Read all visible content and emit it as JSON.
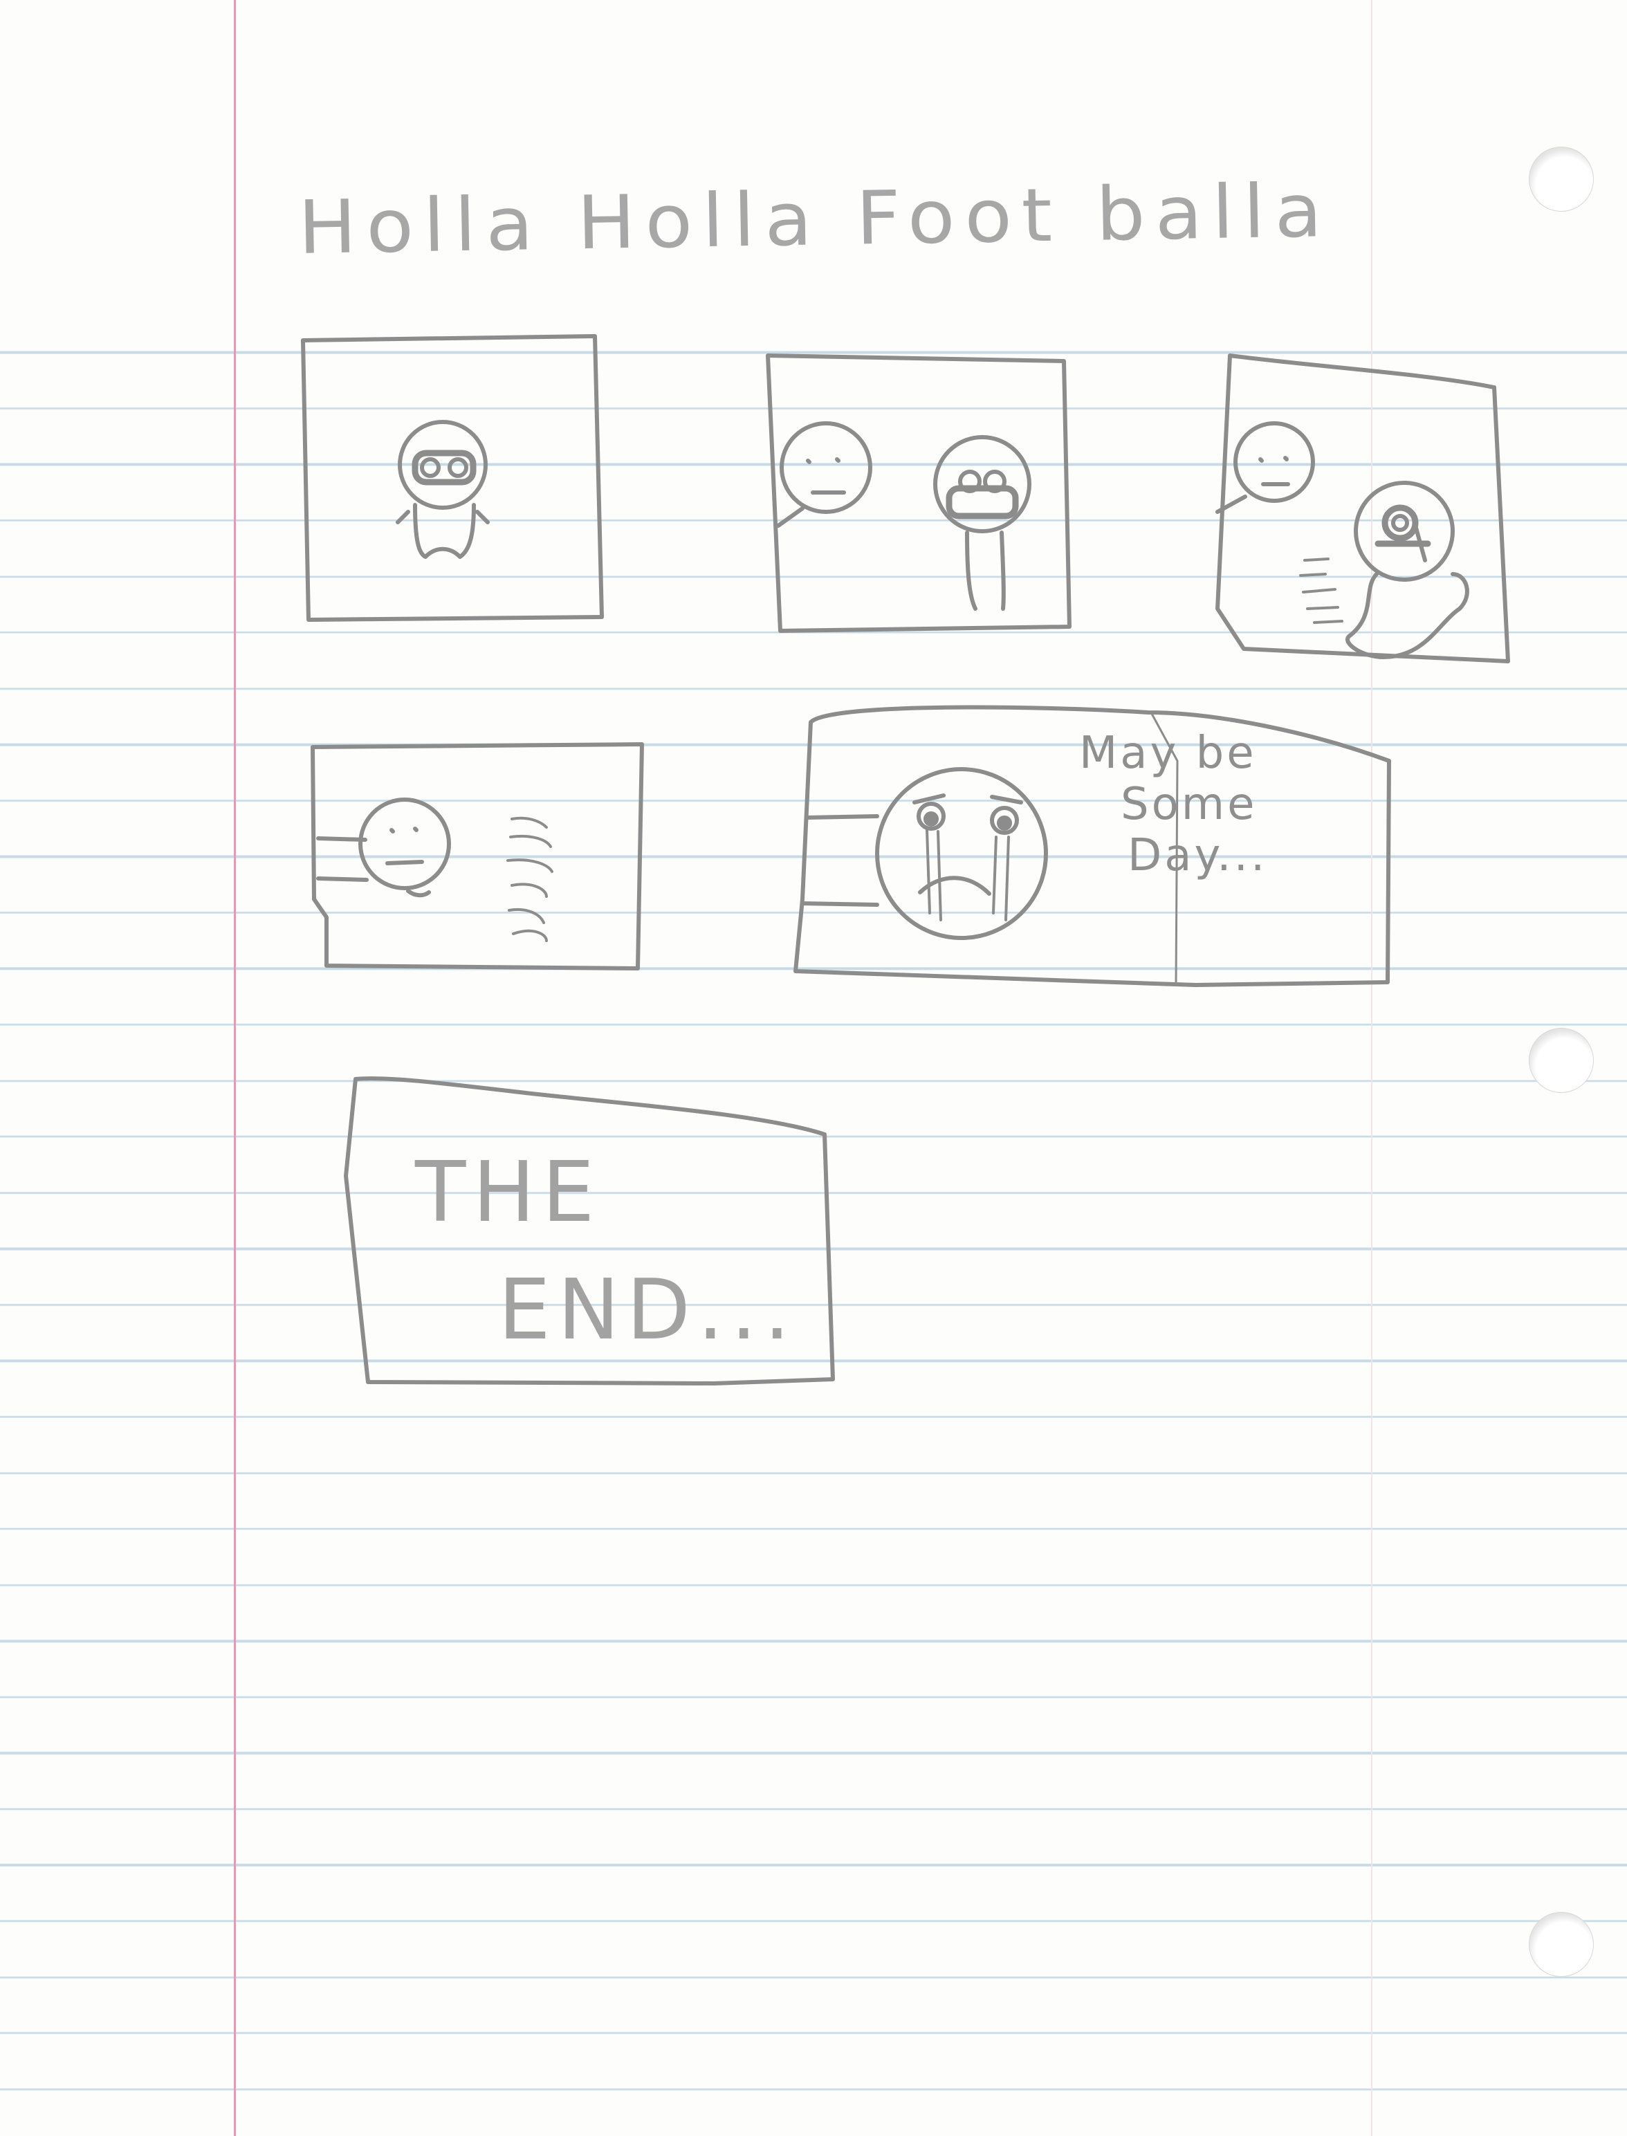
{
  "title": "Holla Holla Foot balla",
  "panels": [
    {
      "id": 1,
      "description_text": ""
    },
    {
      "id": 2,
      "description_text": ""
    },
    {
      "id": 3,
      "description_text": ""
    },
    {
      "id": 4,
      "description_text": ""
    },
    {
      "id": 5,
      "speech": [
        "May be",
        "Some",
        "Day..."
      ]
    },
    {
      "id": 6,
      "caption": [
        "THE",
        "END..."
      ]
    }
  ],
  "colors": {
    "paper": "#fdfdfc",
    "rule_line": "#c6dbe6",
    "margin_line": "#e39ab7",
    "pencil": "#8c8c8c"
  }
}
